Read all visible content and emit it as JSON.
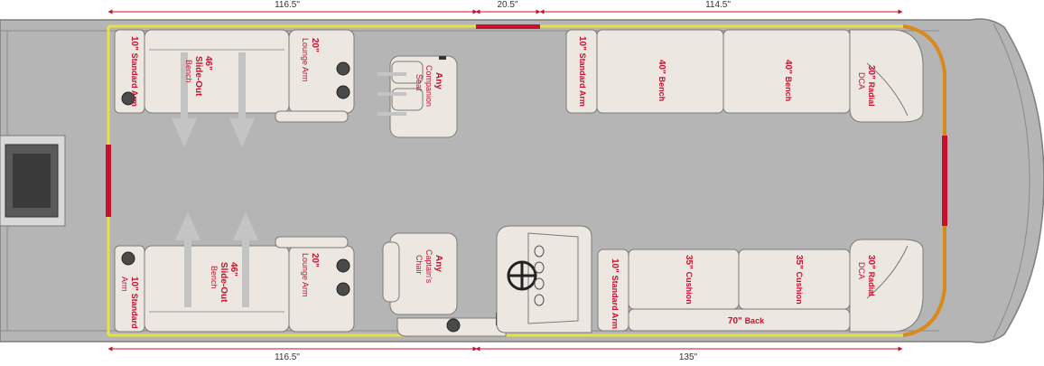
{
  "dimensions": {
    "top_left": "116.5\"",
    "top_mid": "20.5\"",
    "top_right": "114.5\"",
    "bottom_left": "116.5\"",
    "bottom_right": "135\""
  },
  "colors": {
    "deck": "#b5b5b5",
    "deck_outline": "#7d7d7d",
    "rail": "#e6e14a",
    "gate": "#c8102e",
    "bow_rail": "#d98a1c",
    "seat": "#ece8e1",
    "label": "#c8102e",
    "arrow": "#c4c4c4",
    "dimension": "#c8102e"
  },
  "labels": {
    "tl_arm": {
      "size": "10\"",
      "name": "Standard Arm"
    },
    "tl_bench": {
      "size": "46\"",
      "line2": "Slide-Out",
      "line3": "Bench"
    },
    "tl_lounge": {
      "size": "20\"",
      "name": "Lounge Arm"
    },
    "companion": {
      "line1": "Any",
      "line2": "Companion",
      "line3": "Seat"
    },
    "tr_arm": {
      "size": "10\"",
      "name": "Standard Arm"
    },
    "tr_bench1": {
      "size": "40\"",
      "name": "Bench"
    },
    "tr_bench2": {
      "size": "40\"",
      "name": "Bench"
    },
    "tr_radial": {
      "size": "30\"",
      "line2": "Radial",
      "line3": "DCA"
    },
    "bl_arm": {
      "size": "10\"",
      "name": "Standard",
      "line3": "Arm"
    },
    "bl_bench": {
      "size": "46\"",
      "line2": "Slide-Out",
      "line3": "Bench"
    },
    "bl_lounge": {
      "size": "20\"",
      "name": "Lounge Arm"
    },
    "captain": {
      "line1": "Any",
      "line2": "Captain's",
      "line3": "Chair"
    },
    "br_arm": {
      "size": "10\"",
      "name": "Standard Arm"
    },
    "br_cushion1": {
      "size": "35\"",
      "name": "Cushion"
    },
    "br_cushion2": {
      "size": "35\"",
      "name": "Cushion"
    },
    "br_back": {
      "size": "70\"",
      "name": "Back"
    },
    "br_radial": {
      "size": "30\"",
      "line2": "Radial",
      "line3": "DCA"
    }
  }
}
